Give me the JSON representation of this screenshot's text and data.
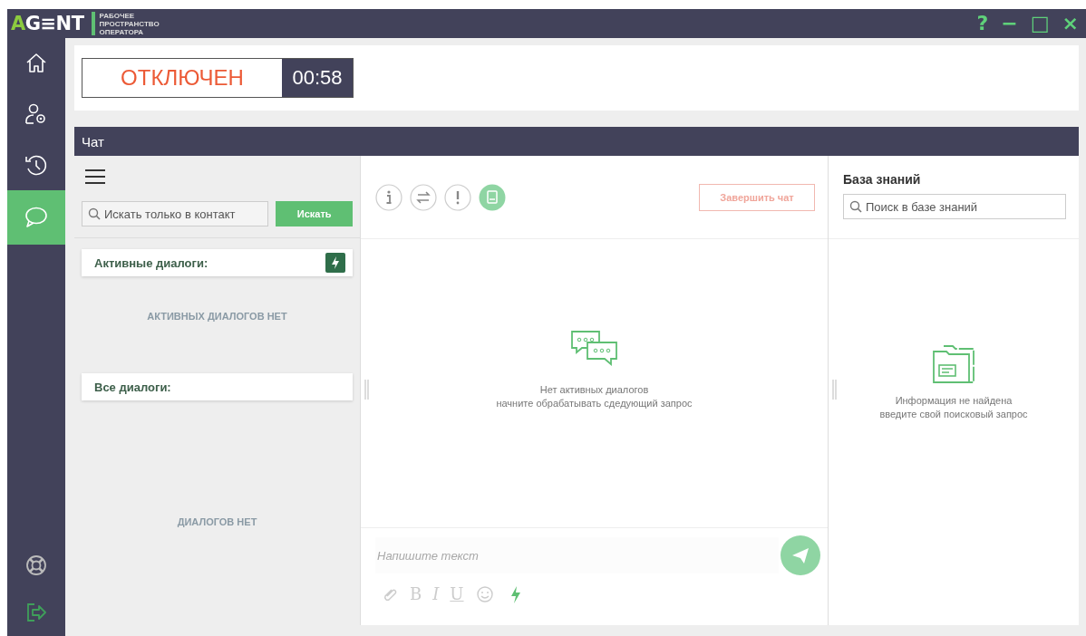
{
  "app": {
    "logo_accent": "A",
    "logo_rest": "G≡NT",
    "subtitle": [
      "РАБОЧЕЕ",
      "ПРОСТРАНСТВО",
      "ОПЕРАТОРА"
    ],
    "window_controls": [
      "?",
      "−",
      "□",
      "×"
    ]
  },
  "sidebar": {
    "items": [
      {
        "kind": "home",
        "selected": false
      },
      {
        "kind": "user-settings",
        "selected": false
      },
      {
        "kind": "history",
        "selected": false
      },
      {
        "kind": "chat",
        "selected": true
      }
    ],
    "bottom_items": [
      {
        "kind": "help"
      },
      {
        "kind": "logout"
      }
    ]
  },
  "status": {
    "label": "ОТКЛЮЧЕН",
    "timer": "00:58"
  },
  "chat": {
    "title": "Чат",
    "contacts": {
      "search": {
        "placeholder": "Искать только в контакт"
      },
      "search_button": "Искать",
      "active": {
        "title": "Активные диалоги:",
        "empty": "АКТИВНЫХ ДИАЛОГОВ НЕТ"
      },
      "all": {
        "title": "Все диалоги:",
        "empty": "ДИАЛОГОВ НЕТ"
      }
    },
    "conversation": {
      "tools": [
        {
          "kind": "info",
          "selected": false
        },
        {
          "kind": "transfer",
          "selected": false
        },
        {
          "kind": "alert",
          "selected": false
        },
        {
          "kind": "book",
          "selected": true
        }
      ],
      "end_button": {
        "label": "Завершить чат",
        "disabled": true
      },
      "empty": [
        "Нет активных диалогов",
        "начните обрабатывать сдедующий запрос"
      ],
      "composer": {
        "placeholder": "Напишите текст",
        "format": [
          {
            "kind": "attach"
          },
          {
            "kind": "text",
            "label": "B"
          },
          {
            "kind": "text",
            "label": "I"
          },
          {
            "kind": "text",
            "label": "U"
          },
          {
            "kind": "emoji"
          },
          {
            "kind": "quick"
          }
        ]
      }
    },
    "knowledge": {
      "title": "База знаний",
      "search": {
        "placeholder": "Поиск в базе знаний"
      },
      "empty": [
        "Информация не найдена",
        "введите свой поисковый запрос"
      ]
    }
  }
}
